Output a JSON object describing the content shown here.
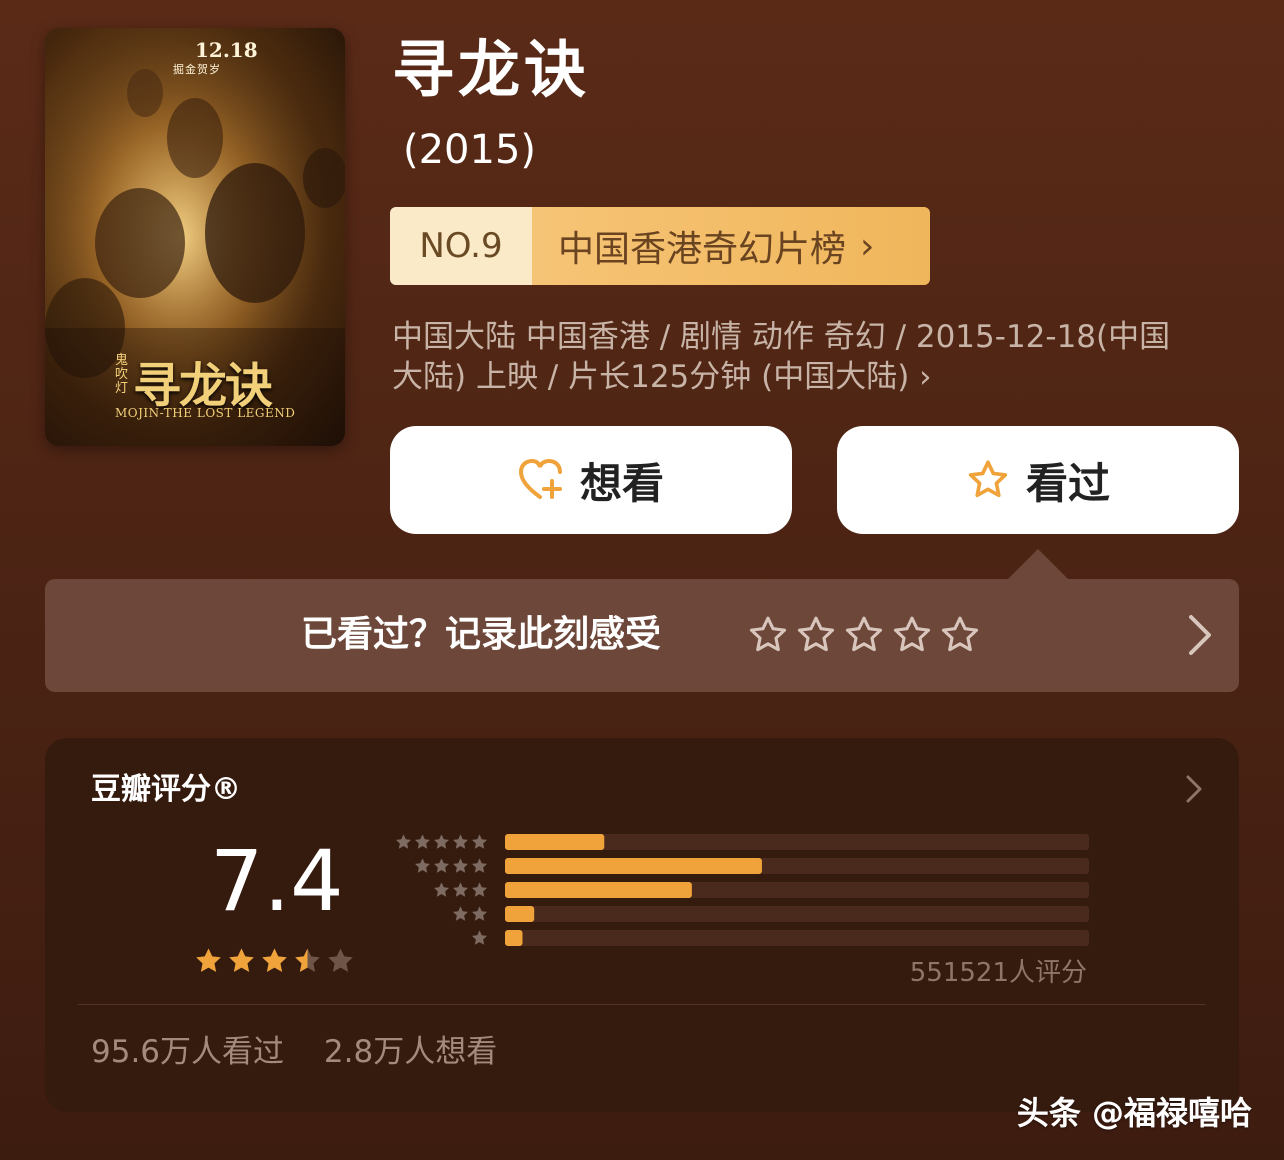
{
  "poster": {
    "date": "12.18",
    "date_sub": "掘金贺岁",
    "title": "寻龙诀",
    "title_prefix": "鬼吹灯",
    "english_title": "MOJIN-THE LOST LEGEND"
  },
  "movie": {
    "title": "寻龙诀",
    "year": "(2015)"
  },
  "rank": {
    "number": "NO.9",
    "list_name": "中国香港奇幻片榜",
    "chevron": "›"
  },
  "meta": {
    "line1": "中国大陆 中国香港 / 剧情 动作 奇幻 / 2015-12-18(中国",
    "line2": "大陆) 上映 / 片长125分钟 (中国大陆)",
    "chevron": "›"
  },
  "actions": {
    "want_label": "想看",
    "seen_label": "看过"
  },
  "record": {
    "prompt": "已看过？记录此刻感受",
    "stars": 5
  },
  "rating": {
    "title": "豆瓣评分®",
    "score": "7.4",
    "stars_value": 3.5,
    "distribution": [
      {
        "stars": 5,
        "fraction": 0.17
      },
      {
        "stars": 4,
        "fraction": 0.44
      },
      {
        "stars": 3,
        "fraction": 0.32
      },
      {
        "stars": 2,
        "fraction": 0.05
      },
      {
        "stars": 1,
        "fraction": 0.03
      }
    ],
    "count": "551521人评分",
    "seen_stat": "95.6万人看过",
    "want_stat": "2.8万人想看"
  },
  "colors": {
    "accent": "#f0a33a",
    "star_filled": "#f0a33a",
    "star_empty": "#6e5548",
    "bar_track": "#4a2a1c"
  },
  "watermark": "头条 @福禄嘻哈"
}
